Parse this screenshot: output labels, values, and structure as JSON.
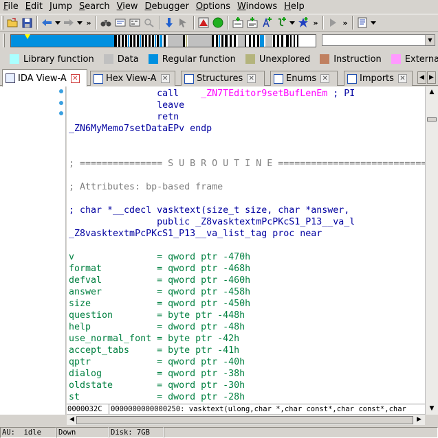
{
  "menu": [
    {
      "label": "File",
      "ul": "F",
      "rest": "ile"
    },
    {
      "label": "Edit",
      "ul": "E",
      "rest": "dit"
    },
    {
      "label": "Jump",
      "ul": "J",
      "rest": "ump"
    },
    {
      "label": "Search",
      "ul": "S",
      "rest": "earch"
    },
    {
      "label": "View",
      "ul": "V",
      "rest": "iew"
    },
    {
      "label": "Debugger",
      "ul": "D",
      "rest": "ebugger"
    },
    {
      "label": "Options",
      "ul": "O",
      "rest": "ptions"
    },
    {
      "label": "Windows",
      "ul": "W",
      "rest": "indows"
    },
    {
      "label": "Help",
      "ul": "H",
      "rest": "elp"
    }
  ],
  "legend": [
    {
      "label": "Library function",
      "color": "#aaffff"
    },
    {
      "label": "Data",
      "color": "#c0c0c0"
    },
    {
      "label": "Regular function",
      "color": "#0090e0"
    },
    {
      "label": "Unexplored",
      "color": "#b4b47c"
    },
    {
      "label": "Instruction",
      "color": "#c08060"
    },
    {
      "label": "External symbol",
      "color": "#ff99ff"
    }
  ],
  "tabs": [
    {
      "label": "IDA View-A",
      "active": true
    },
    {
      "label": "Hex View-A",
      "active": false
    },
    {
      "label": "Structures",
      "active": false
    },
    {
      "label": "Enums",
      "active": false
    },
    {
      "label": "Imports",
      "active": false
    }
  ],
  "listing": [
    {
      "parts": [
        {
          "t": "                ",
          "c": ""
        },
        {
          "t": "call    ",
          "c": "c-blue"
        },
        {
          "t": "_ZN7TEditor9setBufLenEm",
          "c": "c-magenta"
        },
        {
          "t": " ; PI",
          "c": "c-blue"
        }
      ]
    },
    {
      "parts": [
        {
          "t": "                ",
          "c": ""
        },
        {
          "t": "leave",
          "c": "c-blue"
        }
      ]
    },
    {
      "parts": [
        {
          "t": "                ",
          "c": ""
        },
        {
          "t": "retn",
          "c": "c-blue"
        }
      ]
    },
    {
      "parts": [
        {
          "t": "_ZN6MyMemo7setDataEPv endp",
          "c": "c-blue"
        }
      ]
    },
    {
      "parts": []
    },
    {
      "parts": []
    },
    {
      "parts": [
        {
          "t": "; =============== S U B R O U T I N E =======================================",
          "c": "c-gray"
        }
      ]
    },
    {
      "parts": []
    },
    {
      "parts": [
        {
          "t": "; Attributes: bp-based frame",
          "c": "c-gray"
        }
      ]
    },
    {
      "parts": []
    },
    {
      "parts": [
        {
          "t": "; char *__cdecl vasktext(size_t size, char *answer, ",
          "c": "c-blue"
        }
      ]
    },
    {
      "parts": [
        {
          "t": "                ",
          "c": ""
        },
        {
          "t": "public _Z8vasktextmPcPKcS1_P13__va_l",
          "c": "c-blue"
        }
      ]
    },
    {
      "parts": [
        {
          "t": "_Z8vasktextmPcPKcS1_P13__va_list_tag proc near",
          "c": "c-blue"
        }
      ]
    },
    {
      "parts": []
    },
    {
      "parts": [
        {
          "t": "v",
          "c": "c-green"
        },
        {
          "t": "               = qword ptr -470h",
          "c": "c-green"
        }
      ]
    },
    {
      "parts": [
        {
          "t": "format",
          "c": "c-green"
        },
        {
          "t": "          = qword ptr -468h",
          "c": "c-green"
        }
      ]
    },
    {
      "parts": [
        {
          "t": "defval",
          "c": "c-green"
        },
        {
          "t": "          = qword ptr -460h",
          "c": "c-green"
        }
      ]
    },
    {
      "parts": [
        {
          "t": "answer",
          "c": "c-green"
        },
        {
          "t": "          = qword ptr -458h",
          "c": "c-green"
        }
      ]
    },
    {
      "parts": [
        {
          "t": "size",
          "c": "c-green"
        },
        {
          "t": "            = qword ptr -450h",
          "c": "c-green"
        }
      ]
    },
    {
      "parts": [
        {
          "t": "question",
          "c": "c-green"
        },
        {
          "t": "        = byte ptr -448h",
          "c": "c-green"
        }
      ]
    },
    {
      "parts": [
        {
          "t": "help",
          "c": "c-green"
        },
        {
          "t": "            = dword ptr -48h",
          "c": "c-green"
        }
      ]
    },
    {
      "parts": [
        {
          "t": "use_normal_font",
          "c": "c-green"
        },
        {
          "t": " = byte ptr -42h",
          "c": "c-green"
        }
      ]
    },
    {
      "parts": [
        {
          "t": "accept_tabs",
          "c": "c-green"
        },
        {
          "t": "     = byte ptr -41h",
          "c": "c-green"
        }
      ]
    },
    {
      "parts": [
        {
          "t": "qptr",
          "c": "c-green"
        },
        {
          "t": "            = qword ptr -40h",
          "c": "c-green"
        }
      ]
    },
    {
      "parts": [
        {
          "t": "dialog",
          "c": "c-green"
        },
        {
          "t": "          = qword ptr -38h",
          "c": "c-green"
        }
      ]
    },
    {
      "parts": [
        {
          "t": "oldstate",
          "c": "c-green"
        },
        {
          "t": "        = qword ptr -30h",
          "c": "c-green"
        }
      ]
    },
    {
      "parts": [
        {
          "t": "st",
          "c": "c-green"
        },
        {
          "t": "              = dword ptr -28h",
          "c": "c-green"
        }
      ]
    }
  ],
  "address_bar": {
    "offset": "0000032C",
    "location": "0000000000000250: vasktext(ulong,char *,char const*,char const*,char"
  },
  "status": {
    "au": "AU:  idle",
    "direction": "Down",
    "disk": "Disk: 7GB"
  },
  "toolbar_icons": [
    "open-icon",
    "save-icon",
    "back-icon",
    "dropdown-icon",
    "forward-icon",
    "dropdown-icon",
    "more-icon",
    "binoculars-icon",
    "find-text-icon",
    "find-binary-icon",
    "find-next-icon",
    "jump-down-icon",
    "jump-cursor-icon",
    "stop-icon",
    "run-icon",
    "create-code-icon",
    "create-data-icon",
    "create-string-icon",
    "create-struct-icon",
    "name-icon",
    "more-icon",
    "play-icon",
    "more-icon",
    "notes-icon"
  ]
}
